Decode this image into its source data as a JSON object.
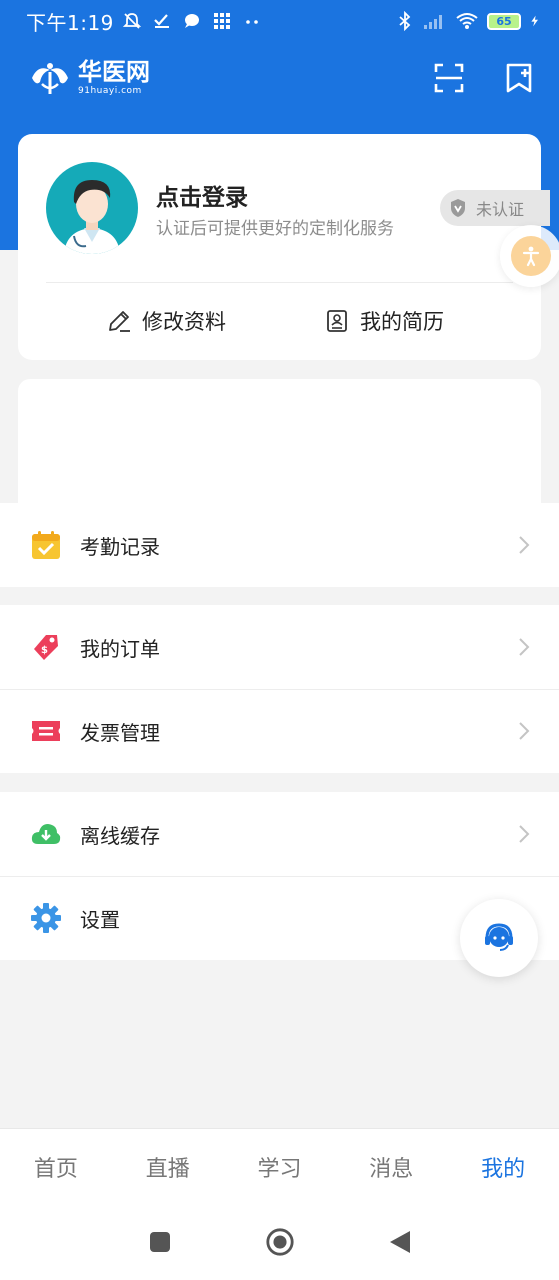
{
  "status_bar": {
    "time": "下午1:19",
    "battery": "65"
  },
  "app": {
    "logo_cn": "华医网",
    "logo_en": "91huayi.com"
  },
  "profile": {
    "login_title": "点击登录",
    "login_subtitle": "认证后可提供更好的定制化服务",
    "verify_badge": "未认证",
    "edit_label": "修改资料",
    "resume_label": "我的简历"
  },
  "menu": {
    "attendance": "考勤记录",
    "orders": "我的订单",
    "invoice": "发票管理",
    "offline": "离线缓存",
    "settings": "设置"
  },
  "tabs": [
    {
      "label": "首页"
    },
    {
      "label": "直播"
    },
    {
      "label": "学习"
    },
    {
      "label": "消息"
    },
    {
      "label": "我的"
    }
  ],
  "colors": {
    "brand": "#1b74e0",
    "background": "#f3f3f3"
  }
}
